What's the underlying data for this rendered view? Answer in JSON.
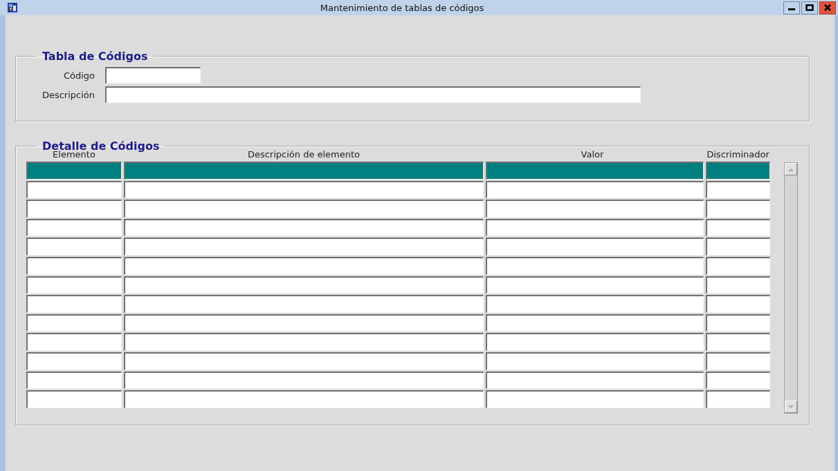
{
  "window": {
    "title": "Mantenimiento de tablas de códigos"
  },
  "code_table": {
    "legend": "Tabla de Códigos",
    "fields": [
      {
        "label": "Código",
        "kind": "short"
      },
      {
        "label": "Descripción",
        "kind": "long"
      }
    ]
  },
  "detail": {
    "legend": "Detalle de Códigos",
    "columns": [
      "Elemento",
      "Descripción de elemento",
      "Valor",
      "Discriminador"
    ],
    "rows": [
      {
        "selected": true
      },
      {
        "selected": false
      },
      {
        "selected": false
      },
      {
        "selected": false
      },
      {
        "selected": false
      },
      {
        "selected": false
      },
      {
        "selected": false
      },
      {
        "selected": false
      },
      {
        "selected": false
      },
      {
        "selected": false
      },
      {
        "selected": false
      },
      {
        "selected": false
      },
      {
        "selected": false
      }
    ]
  }
}
